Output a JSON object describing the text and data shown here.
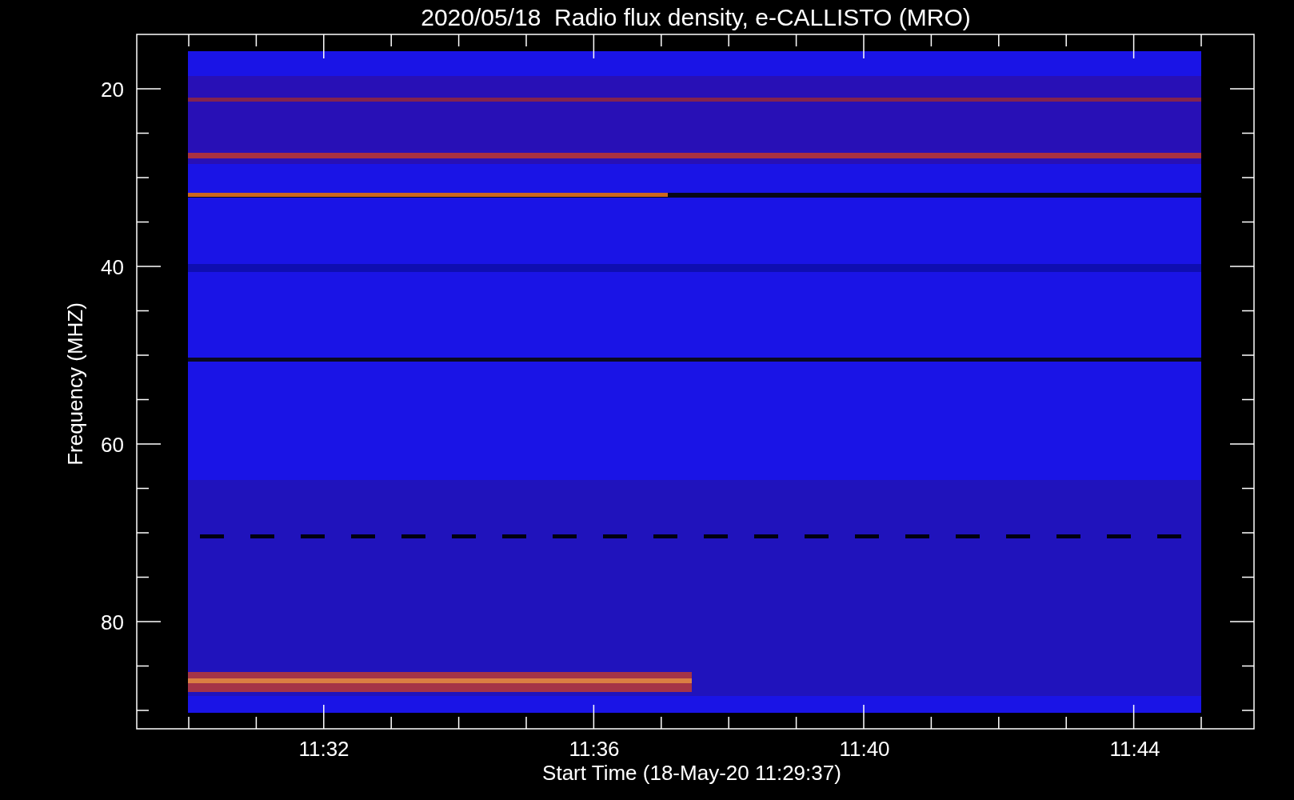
{
  "title": "2020/05/18  Radio flux density, e-CALLISTO (MRO)",
  "y_axis": {
    "label": "Frequency (MHZ)",
    "ticks": [
      "20",
      "40",
      "60",
      "80"
    ]
  },
  "x_axis": {
    "label": "Start Time (18-May-20 11:29:37)",
    "ticks": [
      "11:32",
      "11:36",
      "11:40",
      "11:44"
    ]
  }
}
